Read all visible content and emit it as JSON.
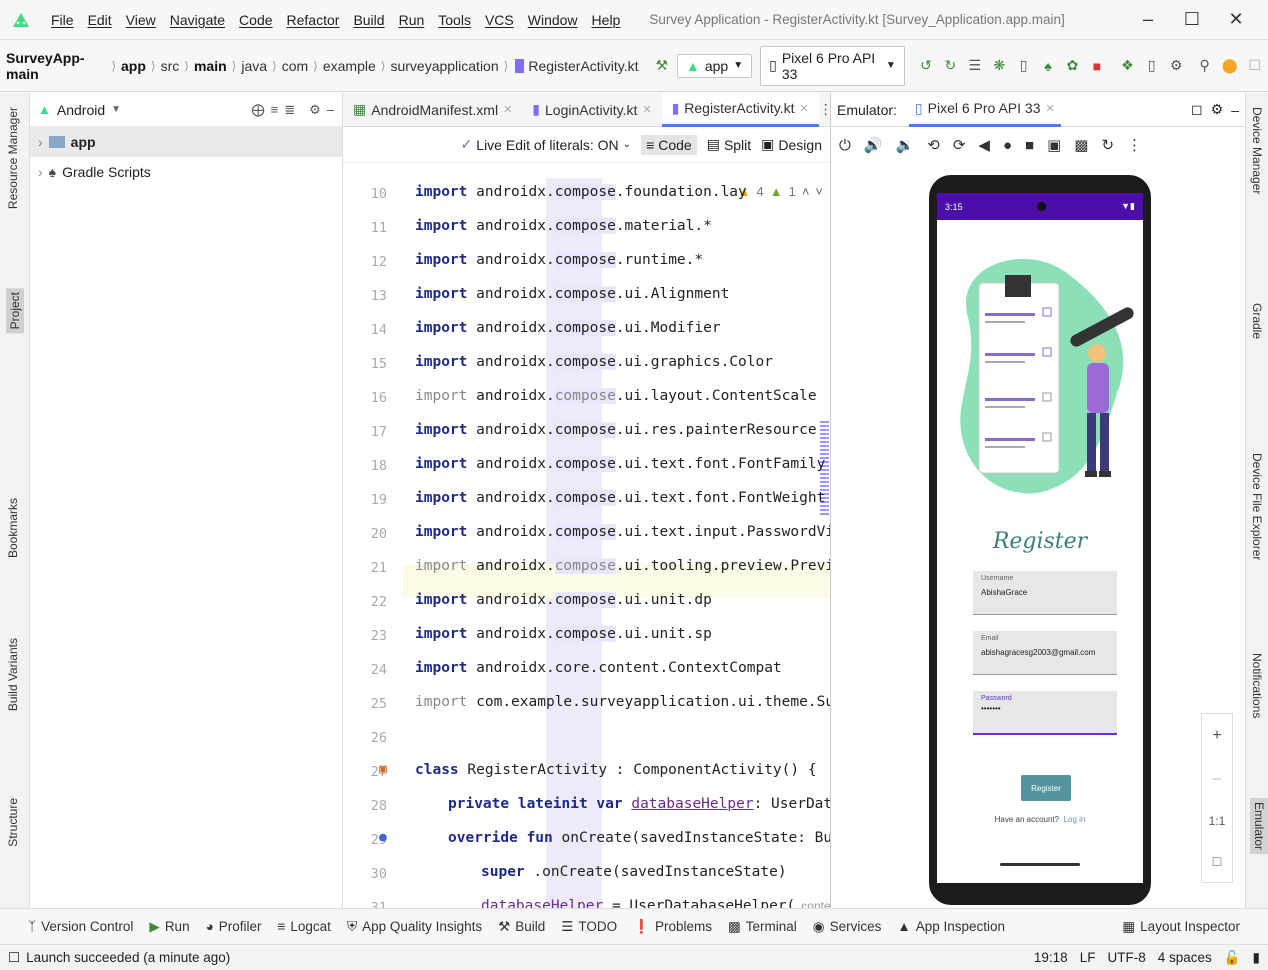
{
  "window": {
    "menu": [
      "File",
      "Edit",
      "View",
      "Navigate",
      "Code",
      "Refactor",
      "Build",
      "Run",
      "Tools",
      "VCS",
      "Window",
      "Help"
    ],
    "title": "Survey Application - RegisterActivity.kt [Survey_Application.app.main]"
  },
  "navbar": {
    "breadcrumbs": [
      "SurveyApp-main",
      "app",
      "src",
      "main",
      "java",
      "com",
      "example",
      "surveyapplication",
      "RegisterActivity.kt"
    ],
    "run_config": "app",
    "device": "Pixel 6 Pro API 33"
  },
  "left_stripe": {
    "resource_manager": "Resource Manager",
    "project": "Project",
    "bookmarks": "Bookmarks",
    "build_variants": "Build Variants",
    "structure": "Structure"
  },
  "right_stripe": {
    "device_manager": "Device Manager",
    "gradle": "Gradle",
    "device_file_explorer": "Device File Explorer",
    "notifications": "Notifications",
    "emulator": "Emulator"
  },
  "project": {
    "view": "Android",
    "tree": [
      {
        "label": "app"
      },
      {
        "label": "Gradle Scripts"
      }
    ]
  },
  "editor": {
    "tabs": [
      {
        "label": "AndroidManifest.xml"
      },
      {
        "label": "LoginActivity.kt"
      },
      {
        "label": "RegisterActivity.kt"
      }
    ],
    "live_edit": "Live Edit of literals: ON",
    "modes": {
      "code": "Code",
      "split": "Split",
      "design": "Design"
    },
    "inspection": {
      "warnings": "4",
      "weak": "1"
    },
    "line_numbers": [
      "10",
      "11",
      "12",
      "13",
      "14",
      "15",
      "16",
      "17",
      "18",
      "19",
      "20",
      "21",
      "22",
      "23",
      "24",
      "25",
      "26",
      "27",
      "28",
      "29",
      "30",
      "31"
    ],
    "lines": {
      "l10": [
        "import",
        " androidx.",
        {
          "hl": "compose"
        },
        ".foundation.lay"
      ],
      "t10": {
        "kw": "import",
        "a": " androidx.",
        "hl": "compose",
        "b": ".foundation.lay"
      },
      "t11": {
        "kw": "import",
        "a": " androidx.",
        "hl": "compose",
        "b": ".material.*"
      },
      "t12": {
        "kw": "import",
        "a": " androidx.",
        "hl": "compose",
        "b": ".runtime.*"
      },
      "t13": {
        "kw": "import",
        "a": " androidx.",
        "hl": "compose",
        "b": ".ui.Alignment"
      },
      "t14": {
        "kw": "import",
        "a": " androidx.",
        "hl": "compose",
        "b": ".ui.Modifier"
      },
      "t15": {
        "kw": "import",
        "a": " androidx.",
        "hl": "compose",
        "b": ".ui.graphics.Color"
      },
      "t16": {
        "kw": "import",
        "a": " androidx.",
        "hl": "compose",
        "b": ".ui.layout.ContentScale"
      },
      "t17": {
        "kw": "import",
        "a": " androidx.",
        "hl": "compose",
        "b": ".ui.res.painterResource"
      },
      "t18": {
        "kw": "import",
        "a": " androidx.",
        "hl": "compose",
        "b": ".ui.text.font.FontFamily"
      },
      "t19": {
        "kw": "import",
        "a": " androidx.",
        "hl": "compose",
        "b": ".ui.text.font.FontWeight"
      },
      "t20": {
        "kw": "import",
        "a": " androidx.",
        "hl": "compose",
        "b": ".ui.text.input.PasswordVisua"
      },
      "t21": {
        "kw": "import",
        "a": " androidx.",
        "hl": "compose",
        "b": ".ui.tooling.preview.Preview"
      },
      "t22": {
        "kw": "import",
        "a": " androidx.",
        "hl": "compose",
        "b": ".ui.unit.dp"
      },
      "t23": {
        "kw": "import",
        "a": " androidx.",
        "hl": "compose",
        "b": ".ui.unit.sp"
      },
      "t24": {
        "kw": "import",
        "a": " androidx.core.content.ContextCompat"
      },
      "t25": {
        "kw": "import",
        "a": " com.example.surveyapplication.ui.theme.Surve"
      },
      "t27": {
        "kw": "class",
        "a": " RegisterActivity : ComponentActivity() {"
      },
      "t28": {
        "kw": "private lateinit var",
        "ul": "databaseHelper",
        "b": ": UserDataba"
      },
      "t29": {
        "kw": "override fun",
        "a": " onCreate(savedInstanceState: Bundl"
      },
      "t30": {
        "kw": "super",
        "a": ".onCreate(savedInstanceState)"
      },
      "t31": {
        "ul": "databaseHelper",
        "a": " = UserDatabaseHelper(",
        "hint": "context:"
      }
    }
  },
  "emulator": {
    "label": "Emulator:",
    "device_tab": "Pixel 6 Pro API 33",
    "app": {
      "status_time": "3:15",
      "title": "Register",
      "username_label": "Username",
      "username_value": "AbishaGrace",
      "email_label": "Email",
      "email_value": "abishagracesg2003@gmail.com",
      "password_label": "Password",
      "password_value": "•••••••",
      "register_button": "Register",
      "have_account": "Have an account?",
      "login_link": "Log in"
    },
    "zoom": {
      "plus": "+",
      "minus": "–",
      "ratio": "1:1"
    }
  },
  "bottom_tools": [
    "Version Control",
    "Run",
    "Profiler",
    "Logcat",
    "App Quality Insights",
    "Build",
    "TODO",
    "Problems",
    "Terminal",
    "Services",
    "App Inspection"
  ],
  "layout_inspector": "Layout Inspector",
  "status": {
    "message": "Launch succeeded (a minute ago)",
    "position": "19:18",
    "line_sep": "LF",
    "encoding": "UTF-8",
    "indent": "4 spaces"
  },
  "colors": {
    "accent": "#4a7fe0",
    "app_bar": "#4b0ea8",
    "register_button": "#54949e",
    "illustration": "#8be0b8"
  }
}
